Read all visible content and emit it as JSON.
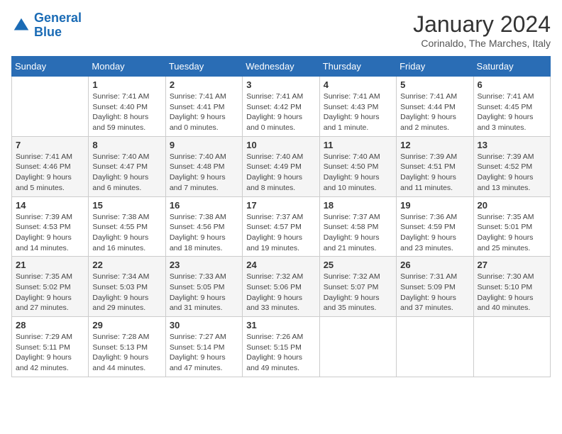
{
  "header": {
    "logo_line1": "General",
    "logo_line2": "Blue",
    "month": "January 2024",
    "location": "Corinaldo, The Marches, Italy"
  },
  "columns": [
    "Sunday",
    "Monday",
    "Tuesday",
    "Wednesday",
    "Thursday",
    "Friday",
    "Saturday"
  ],
  "weeks": [
    [
      {
        "day": "",
        "info": ""
      },
      {
        "day": "1",
        "info": "Sunrise: 7:41 AM\nSunset: 4:40 PM\nDaylight: 8 hours\nand 59 minutes."
      },
      {
        "day": "2",
        "info": "Sunrise: 7:41 AM\nSunset: 4:41 PM\nDaylight: 9 hours\nand 0 minutes."
      },
      {
        "day": "3",
        "info": "Sunrise: 7:41 AM\nSunset: 4:42 PM\nDaylight: 9 hours\nand 0 minutes."
      },
      {
        "day": "4",
        "info": "Sunrise: 7:41 AM\nSunset: 4:43 PM\nDaylight: 9 hours\nand 1 minute."
      },
      {
        "day": "5",
        "info": "Sunrise: 7:41 AM\nSunset: 4:44 PM\nDaylight: 9 hours\nand 2 minutes."
      },
      {
        "day": "6",
        "info": "Sunrise: 7:41 AM\nSunset: 4:45 PM\nDaylight: 9 hours\nand 3 minutes."
      }
    ],
    [
      {
        "day": "7",
        "info": "Sunrise: 7:41 AM\nSunset: 4:46 PM\nDaylight: 9 hours\nand 5 minutes."
      },
      {
        "day": "8",
        "info": "Sunrise: 7:40 AM\nSunset: 4:47 PM\nDaylight: 9 hours\nand 6 minutes."
      },
      {
        "day": "9",
        "info": "Sunrise: 7:40 AM\nSunset: 4:48 PM\nDaylight: 9 hours\nand 7 minutes."
      },
      {
        "day": "10",
        "info": "Sunrise: 7:40 AM\nSunset: 4:49 PM\nDaylight: 9 hours\nand 8 minutes."
      },
      {
        "day": "11",
        "info": "Sunrise: 7:40 AM\nSunset: 4:50 PM\nDaylight: 9 hours\nand 10 minutes."
      },
      {
        "day": "12",
        "info": "Sunrise: 7:39 AM\nSunset: 4:51 PM\nDaylight: 9 hours\nand 11 minutes."
      },
      {
        "day": "13",
        "info": "Sunrise: 7:39 AM\nSunset: 4:52 PM\nDaylight: 9 hours\nand 13 minutes."
      }
    ],
    [
      {
        "day": "14",
        "info": "Sunrise: 7:39 AM\nSunset: 4:53 PM\nDaylight: 9 hours\nand 14 minutes."
      },
      {
        "day": "15",
        "info": "Sunrise: 7:38 AM\nSunset: 4:55 PM\nDaylight: 9 hours\nand 16 minutes."
      },
      {
        "day": "16",
        "info": "Sunrise: 7:38 AM\nSunset: 4:56 PM\nDaylight: 9 hours\nand 18 minutes."
      },
      {
        "day": "17",
        "info": "Sunrise: 7:37 AM\nSunset: 4:57 PM\nDaylight: 9 hours\nand 19 minutes."
      },
      {
        "day": "18",
        "info": "Sunrise: 7:37 AM\nSunset: 4:58 PM\nDaylight: 9 hours\nand 21 minutes."
      },
      {
        "day": "19",
        "info": "Sunrise: 7:36 AM\nSunset: 4:59 PM\nDaylight: 9 hours\nand 23 minutes."
      },
      {
        "day": "20",
        "info": "Sunrise: 7:35 AM\nSunset: 5:01 PM\nDaylight: 9 hours\nand 25 minutes."
      }
    ],
    [
      {
        "day": "21",
        "info": "Sunrise: 7:35 AM\nSunset: 5:02 PM\nDaylight: 9 hours\nand 27 minutes."
      },
      {
        "day": "22",
        "info": "Sunrise: 7:34 AM\nSunset: 5:03 PM\nDaylight: 9 hours\nand 29 minutes."
      },
      {
        "day": "23",
        "info": "Sunrise: 7:33 AM\nSunset: 5:05 PM\nDaylight: 9 hours\nand 31 minutes."
      },
      {
        "day": "24",
        "info": "Sunrise: 7:32 AM\nSunset: 5:06 PM\nDaylight: 9 hours\nand 33 minutes."
      },
      {
        "day": "25",
        "info": "Sunrise: 7:32 AM\nSunset: 5:07 PM\nDaylight: 9 hours\nand 35 minutes."
      },
      {
        "day": "26",
        "info": "Sunrise: 7:31 AM\nSunset: 5:09 PM\nDaylight: 9 hours\nand 37 minutes."
      },
      {
        "day": "27",
        "info": "Sunrise: 7:30 AM\nSunset: 5:10 PM\nDaylight: 9 hours\nand 40 minutes."
      }
    ],
    [
      {
        "day": "28",
        "info": "Sunrise: 7:29 AM\nSunset: 5:11 PM\nDaylight: 9 hours\nand 42 minutes."
      },
      {
        "day": "29",
        "info": "Sunrise: 7:28 AM\nSunset: 5:13 PM\nDaylight: 9 hours\nand 44 minutes."
      },
      {
        "day": "30",
        "info": "Sunrise: 7:27 AM\nSunset: 5:14 PM\nDaylight: 9 hours\nand 47 minutes."
      },
      {
        "day": "31",
        "info": "Sunrise: 7:26 AM\nSunset: 5:15 PM\nDaylight: 9 hours\nand 49 minutes."
      },
      {
        "day": "",
        "info": ""
      },
      {
        "day": "",
        "info": ""
      },
      {
        "day": "",
        "info": ""
      }
    ]
  ]
}
